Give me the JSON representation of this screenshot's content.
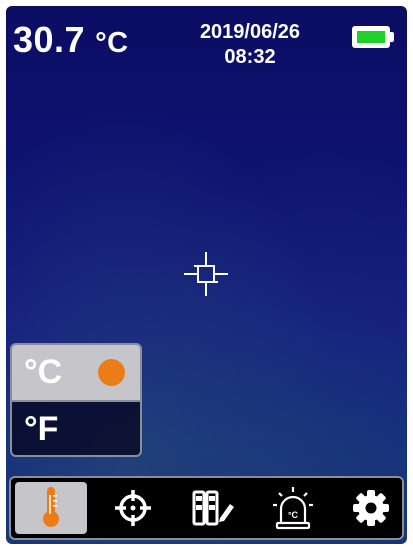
{
  "status": {
    "temperature": "30.7",
    "temperature_unit": "°C",
    "date": "2019/06/26",
    "time": "08:32",
    "battery_icon": "battery-full-icon"
  },
  "unit_menu": {
    "options": [
      {
        "label": "°C",
        "selected": true
      },
      {
        "label": "°F",
        "selected": false
      }
    ],
    "selected_color": "#ec7c17"
  },
  "toolbar": {
    "items": [
      {
        "icon": "thermometer-icon",
        "active": true
      },
      {
        "icon": "crosshair-target-icon",
        "active": false
      },
      {
        "icon": "palette-edit-icon",
        "active": false
      },
      {
        "icon": "temperature-alarm-icon",
        "active": false
      },
      {
        "icon": "gear-icon",
        "active": false
      }
    ],
    "accent_color": "#ec7c17"
  }
}
